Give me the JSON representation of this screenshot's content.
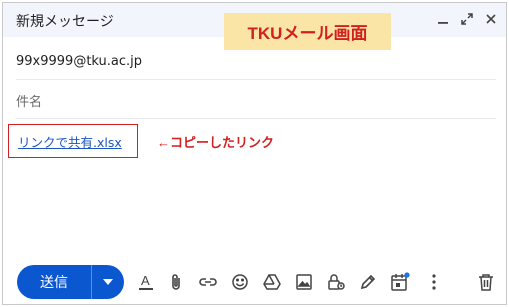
{
  "window": {
    "title": "新規メッセージ"
  },
  "annotations": {
    "title_callout": "TKUメール画面",
    "arrow_note": "←コピーしたリンク"
  },
  "compose": {
    "to": "99x9999@tku.ac.jp",
    "subject_placeholder": "件名",
    "body_link": "リンクで共有.xlsx"
  },
  "toolbar": {
    "send_label": "送信",
    "icons": [
      "text-format-icon",
      "attach-icon",
      "link-icon",
      "emoji-icon",
      "drive-icon",
      "photo-icon",
      "lock-timer-icon",
      "signature-pen-icon",
      "schedule-calendar-icon",
      "more-vert-icon",
      "trash-icon"
    ]
  },
  "colors": {
    "send_button": "#0b57d0",
    "annotation_red": "#d0201f",
    "callout_bg": "#fbe5a6",
    "link_blue": "#1a55c2"
  }
}
